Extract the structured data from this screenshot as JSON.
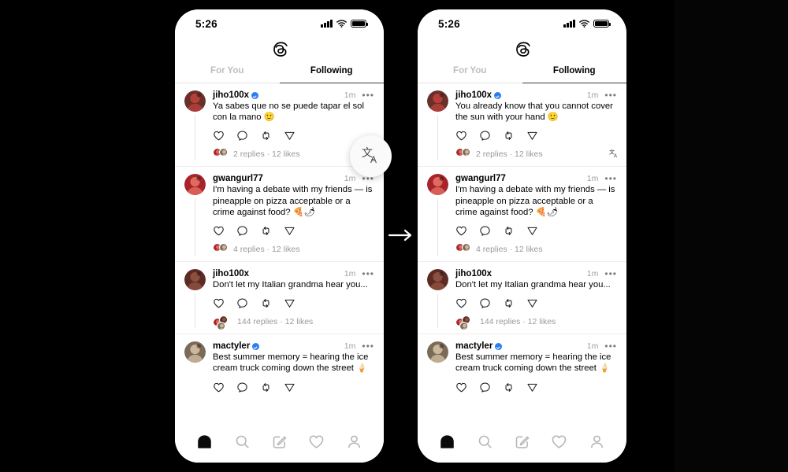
{
  "figure": {
    "background_color": "#000000",
    "arrow_icon": "arrow-right-icon",
    "arrow_color": "#ffffff",
    "fab_icon": "translate-icon",
    "fab_label": "文A"
  },
  "phones": [
    {
      "id": "before",
      "status_bar": {
        "time": "5:26",
        "signal_icon": "cellular-signal-icon",
        "wifi_icon": "wifi-icon",
        "battery_icon": "battery-full-icon"
      },
      "app": {
        "logo_icon": "threads-logo-icon",
        "tabs": [
          {
            "label": "For You",
            "active": false
          },
          {
            "label": "Following",
            "active": true
          }
        ]
      },
      "posts": [
        {
          "username": "jiho100x",
          "verified": true,
          "time": "1m",
          "more_icon": "more-options-icon",
          "text": "Ya sabes que no se puede tapar el sol con la mano 🙂",
          "actions": [
            "like-icon",
            "comment-icon",
            "repost-icon",
            "share-icon"
          ],
          "replies": "2 replies",
          "likes": "12 likes",
          "reply_avatars": 2,
          "translate_badge": false
        },
        {
          "username": "gwangurl77",
          "verified": false,
          "time": "1m",
          "more_icon": "more-options-icon",
          "text": "I'm having a debate with my friends — is pineapple on pizza acceptable or a crime against food? 🍕🌶",
          "actions": [
            "like-icon",
            "comment-icon",
            "repost-icon",
            "share-icon"
          ],
          "replies": "4 replies",
          "likes": "12 likes",
          "reply_avatars": 2,
          "translate_badge": false
        },
        {
          "username": "jiho100x",
          "verified": false,
          "time": "1m",
          "more_icon": "more-options-icon",
          "text": "Don't let my Italian grandma hear you...",
          "actions": [
            "like-icon",
            "comment-icon",
            "repost-icon",
            "share-icon"
          ],
          "replies": "144 replies",
          "likes": "12 likes",
          "reply_avatars": 3,
          "translate_badge": false
        },
        {
          "username": "mactyler",
          "verified": true,
          "time": "1m",
          "more_icon": "more-options-icon",
          "text": "Best summer memory = hearing the ice cream truck coming down the street 🍦",
          "actions": [
            "like-icon",
            "comment-icon",
            "repost-icon",
            "share-icon"
          ],
          "replies": "",
          "likes": "",
          "reply_avatars": 0,
          "translate_badge": false
        }
      ],
      "nav": [
        {
          "icon": "home-icon",
          "active": true
        },
        {
          "icon": "search-icon",
          "active": false
        },
        {
          "icon": "compose-icon",
          "active": false
        },
        {
          "icon": "activity-heart-icon",
          "active": false
        },
        {
          "icon": "profile-icon",
          "active": false
        }
      ]
    },
    {
      "id": "after",
      "status_bar": {
        "time": "5:26",
        "signal_icon": "cellular-signal-icon",
        "wifi_icon": "wifi-icon",
        "battery_icon": "battery-full-icon"
      },
      "app": {
        "logo_icon": "threads-logo-icon",
        "tabs": [
          {
            "label": "For You",
            "active": false
          },
          {
            "label": "Following",
            "active": true
          }
        ]
      },
      "posts": [
        {
          "username": "jiho100x",
          "verified": true,
          "time": "1m",
          "more_icon": "more-options-icon",
          "text": "You already know that you cannot cover the sun with your hand 🙂",
          "actions": [
            "like-icon",
            "comment-icon",
            "repost-icon",
            "share-icon"
          ],
          "replies": "2 replies",
          "likes": "12 likes",
          "reply_avatars": 2,
          "translate_badge": true
        },
        {
          "username": "gwangurl77",
          "verified": false,
          "time": "1m",
          "more_icon": "more-options-icon",
          "text": "I'm having a debate with my friends — is pineapple on pizza acceptable or a crime against food? 🍕🌶",
          "actions": [
            "like-icon",
            "comment-icon",
            "repost-icon",
            "share-icon"
          ],
          "replies": "4 replies",
          "likes": "12 likes",
          "reply_avatars": 2,
          "translate_badge": false
        },
        {
          "username": "jiho100x",
          "verified": false,
          "time": "1m",
          "more_icon": "more-options-icon",
          "text": "Don't let my Italian grandma hear you...",
          "actions": [
            "like-icon",
            "comment-icon",
            "repost-icon",
            "share-icon"
          ],
          "replies": "144 replies",
          "likes": "12 likes",
          "reply_avatars": 3,
          "translate_badge": false
        },
        {
          "username": "mactyler",
          "verified": true,
          "time": "1m",
          "more_icon": "more-options-icon",
          "text": "Best summer memory = hearing the ice cream truck coming down the street 🍦",
          "actions": [
            "like-icon",
            "comment-icon",
            "repost-icon",
            "share-icon"
          ],
          "replies": "",
          "likes": "",
          "reply_avatars": 0,
          "translate_badge": false
        }
      ],
      "nav": [
        {
          "icon": "home-icon",
          "active": true
        },
        {
          "icon": "search-icon",
          "active": false
        },
        {
          "icon": "compose-icon",
          "active": false
        },
        {
          "icon": "activity-heart-icon",
          "active": false
        },
        {
          "icon": "profile-icon",
          "active": false
        }
      ]
    }
  ],
  "separator": " · "
}
